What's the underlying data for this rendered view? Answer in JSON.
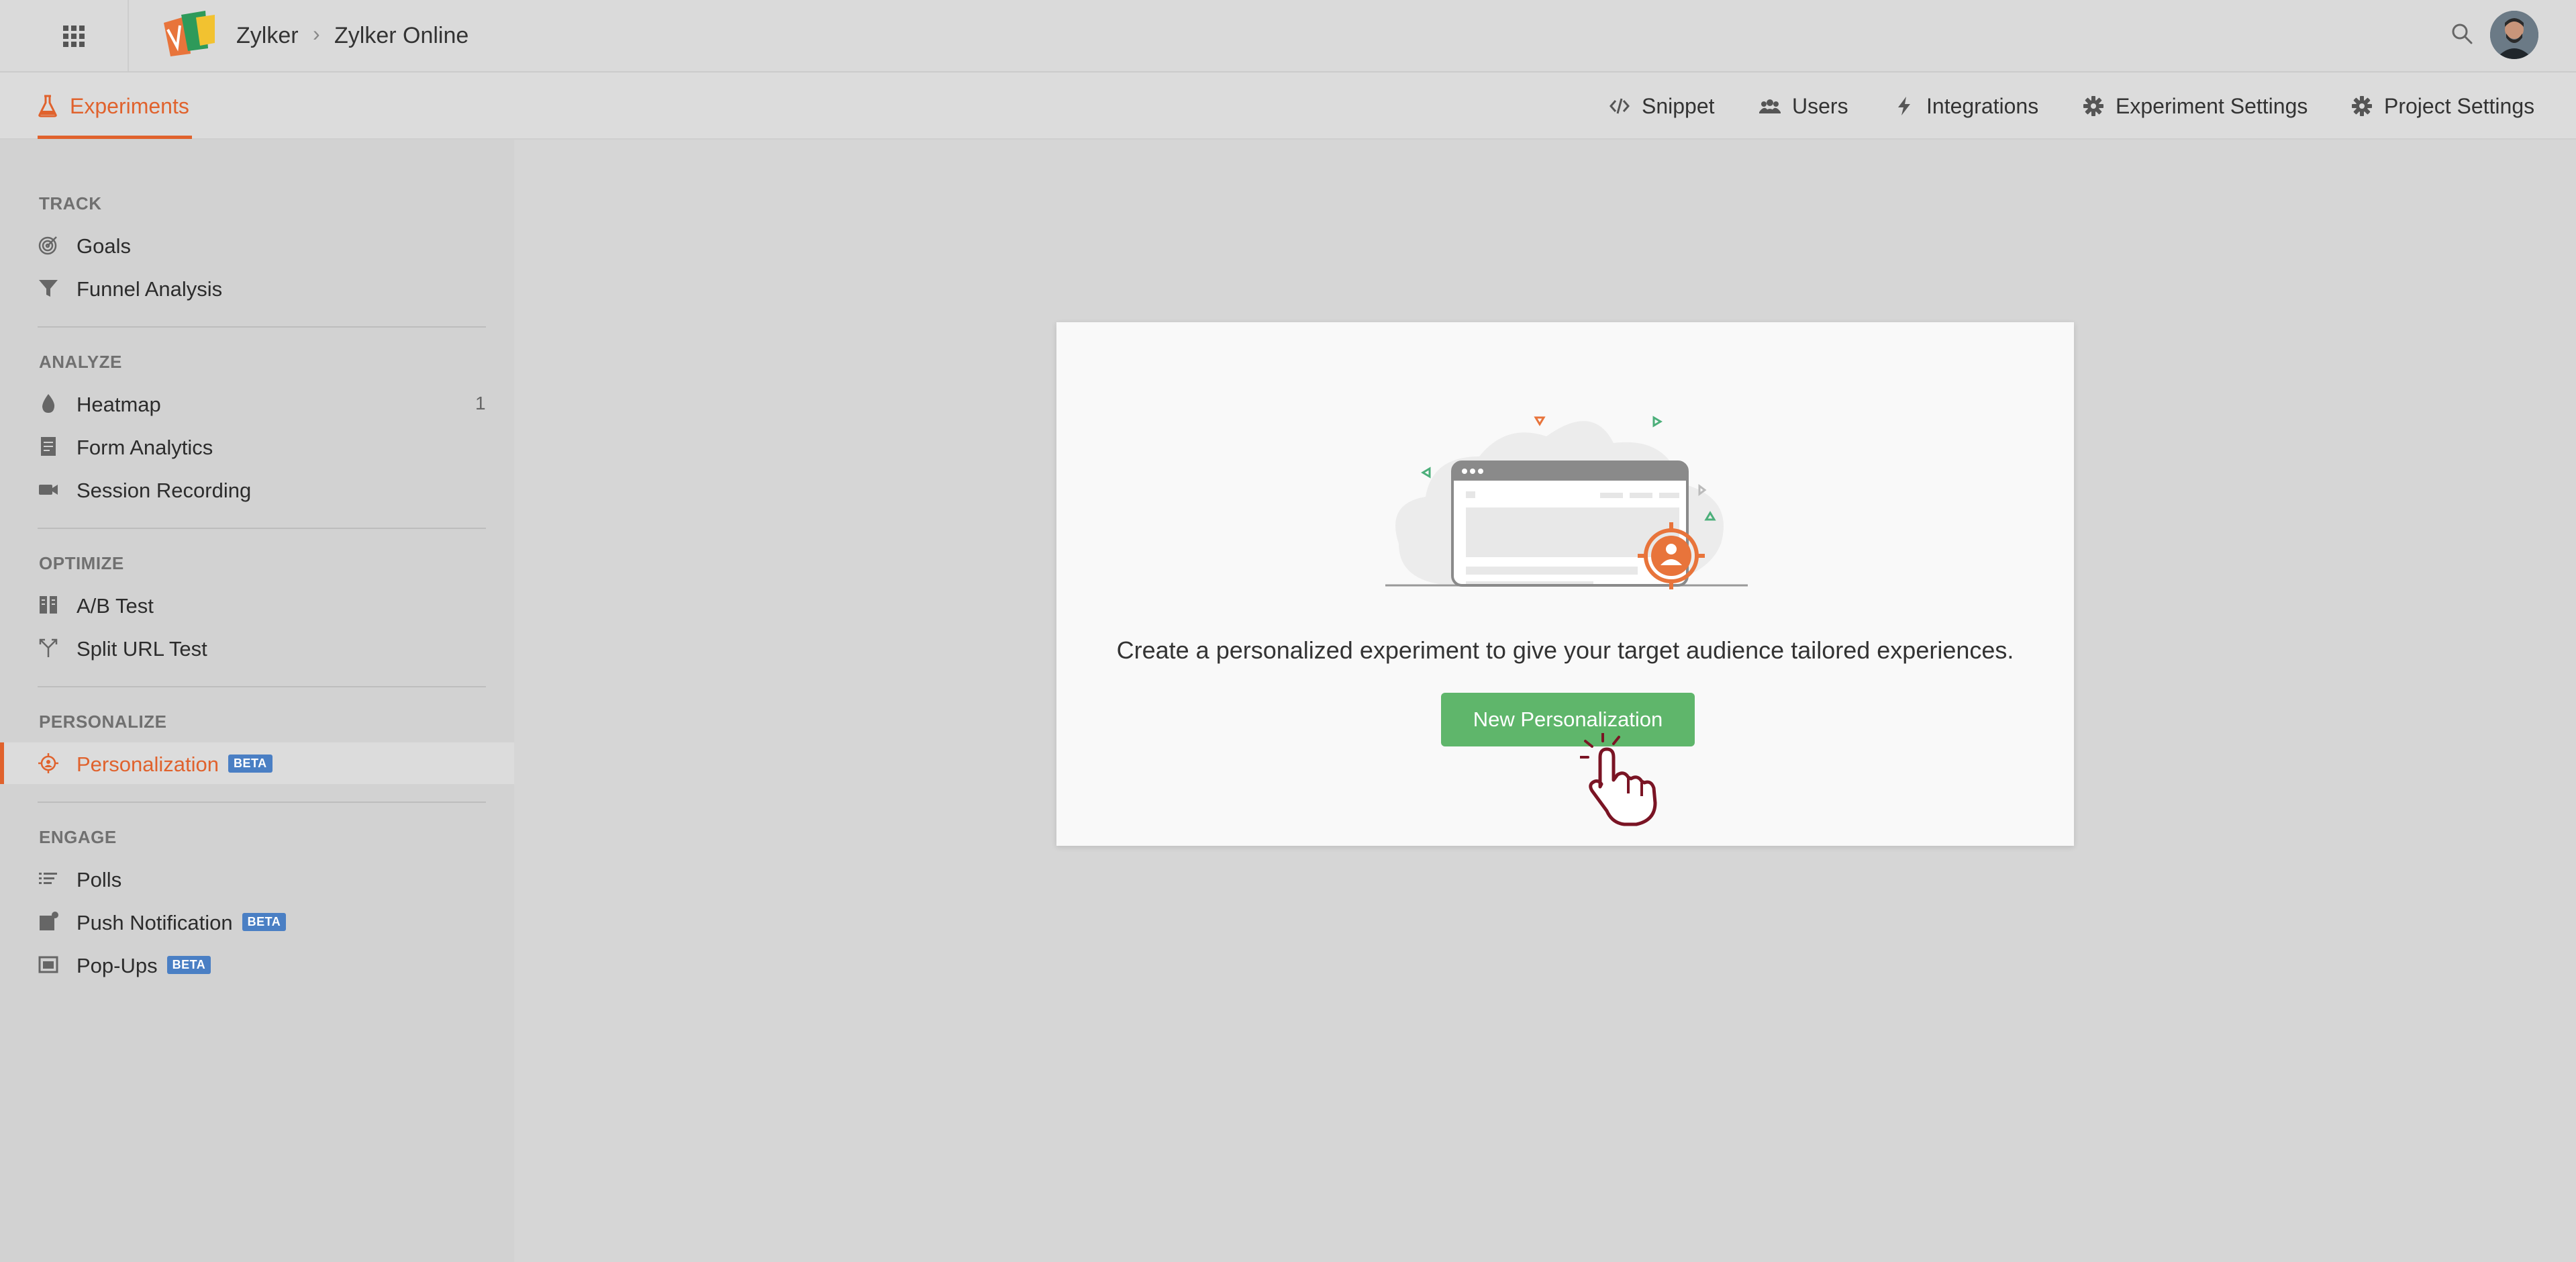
{
  "header": {
    "breadcrumb": [
      "Zylker",
      "Zylker Online"
    ],
    "separator": "›"
  },
  "subnav": {
    "active_tab": "Experiments",
    "links": [
      "Snippet",
      "Users",
      "Integrations",
      "Experiment Settings",
      "Project Settings"
    ]
  },
  "sidebar": {
    "sections": [
      {
        "title": "TRACK",
        "items": [
          {
            "label": "Goals",
            "icon": "target-icon"
          },
          {
            "label": "Funnel Analysis",
            "icon": "funnel-icon"
          }
        ]
      },
      {
        "title": "ANALYZE",
        "items": [
          {
            "label": "Heatmap",
            "icon": "flame-icon",
            "count": "1"
          },
          {
            "label": "Form Analytics",
            "icon": "form-icon"
          },
          {
            "label": "Session Recording",
            "icon": "camera-icon"
          }
        ]
      },
      {
        "title": "OPTIMIZE",
        "items": [
          {
            "label": "A/B Test",
            "icon": "ab-icon"
          },
          {
            "label": "Split URL Test",
            "icon": "split-icon"
          }
        ]
      },
      {
        "title": "PERSONALIZE",
        "items": [
          {
            "label": "Personalization",
            "icon": "crosshair-user-icon",
            "badge": "BETA",
            "active": true
          }
        ]
      },
      {
        "title": "ENGAGE",
        "items": [
          {
            "label": "Polls",
            "icon": "list-icon"
          },
          {
            "label": "Push Notification",
            "icon": "bell-box-icon",
            "badge": "BETA"
          },
          {
            "label": "Pop-Ups",
            "icon": "window-icon",
            "badge": "BETA"
          }
        ]
      }
    ]
  },
  "main": {
    "message": "Create a personalized experiment to give your target audience tailored experiences.",
    "button_label": "New Personalization"
  },
  "colors": {
    "accent": "#e0622d",
    "button": "#5fb66b",
    "beta_badge": "#4a7fc4"
  }
}
